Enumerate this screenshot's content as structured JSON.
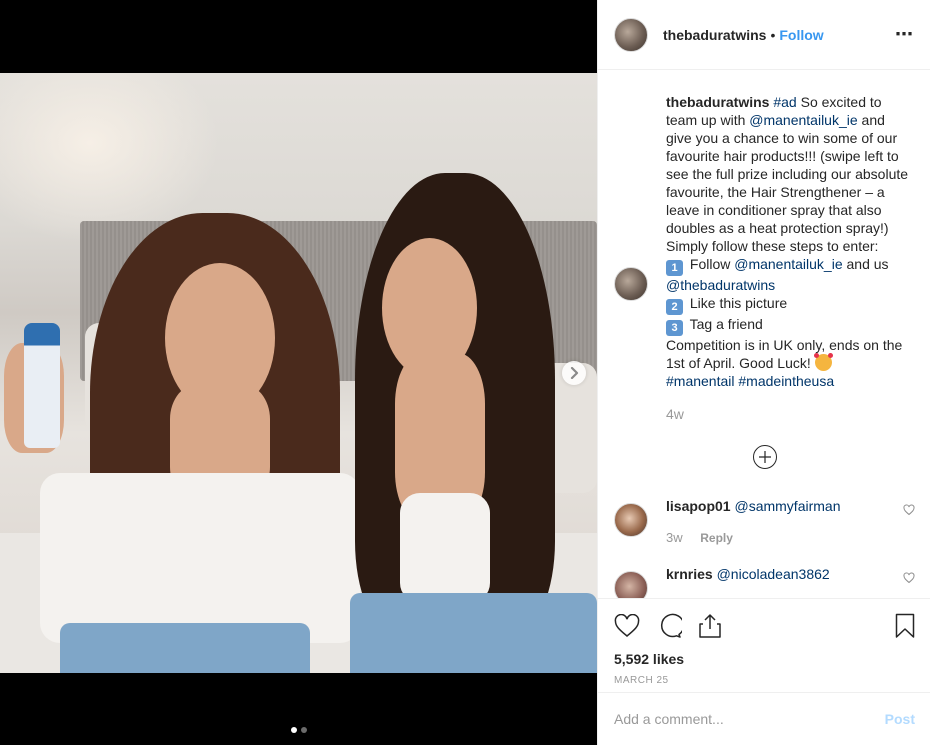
{
  "post": {
    "media": {
      "image_description": "Two women with long dark hair sitting on a bed, one holding a hair spray bottle",
      "carousel_dots": 2,
      "active_dot": 0,
      "next_icon": "chevron-right-icon"
    },
    "header": {
      "username": "thebaduratwins",
      "separator": "•",
      "follow_label": "Follow",
      "more_icon": "⋯"
    },
    "caption": {
      "username": "thebaduratwins",
      "hashtag_ad": "#ad",
      "text1": " So excited to team up with ",
      "mention1": "@manentailuk_ie",
      "text2": " and give you a chance to win some of our favourite hair products!!! (swipe left to see the full prize including our absolute favourite, the Hair Strengthener – a leave in conditioner spray that also doubles as a heat protection spray!)",
      "steps_intro": "Simply follow these steps to enter:",
      "step1_num": "1",
      "step1_text": " Follow ",
      "step1_mention1": "@manentailuk_ie",
      "step1_and": " and us ",
      "step1_mention2": "@thebaduratwins",
      "step2_num": "2",
      "step2_text": " Like this picture",
      "step3_num": "3",
      "step3_text": " Tag a friend",
      "closing": "Competition is in UK only, ends on the 1st of April. Good Luck! ",
      "emoji": "smiling-face-with-hearts",
      "hashtag1": "#manentail",
      "hashtag2": "#madeintheusa",
      "time": "4w"
    },
    "load_more_icon": "plus-circle-icon",
    "comments": [
      {
        "username": "lisapop01",
        "mention": "@sammyfairman",
        "time": "3w",
        "reply_label": "Reply"
      },
      {
        "username": "krnries",
        "mention": "@nicoladean3862"
      }
    ],
    "actions": {
      "likes": "5,592 likes",
      "date": "MARCH 25"
    },
    "add_comment": {
      "placeholder": "Add a comment...",
      "post_label": "Post"
    },
    "colors": {
      "link_blue": "#003569",
      "follow_blue": "#3897f0",
      "post_disabled": "#b3dbff",
      "muted": "#999999"
    }
  }
}
